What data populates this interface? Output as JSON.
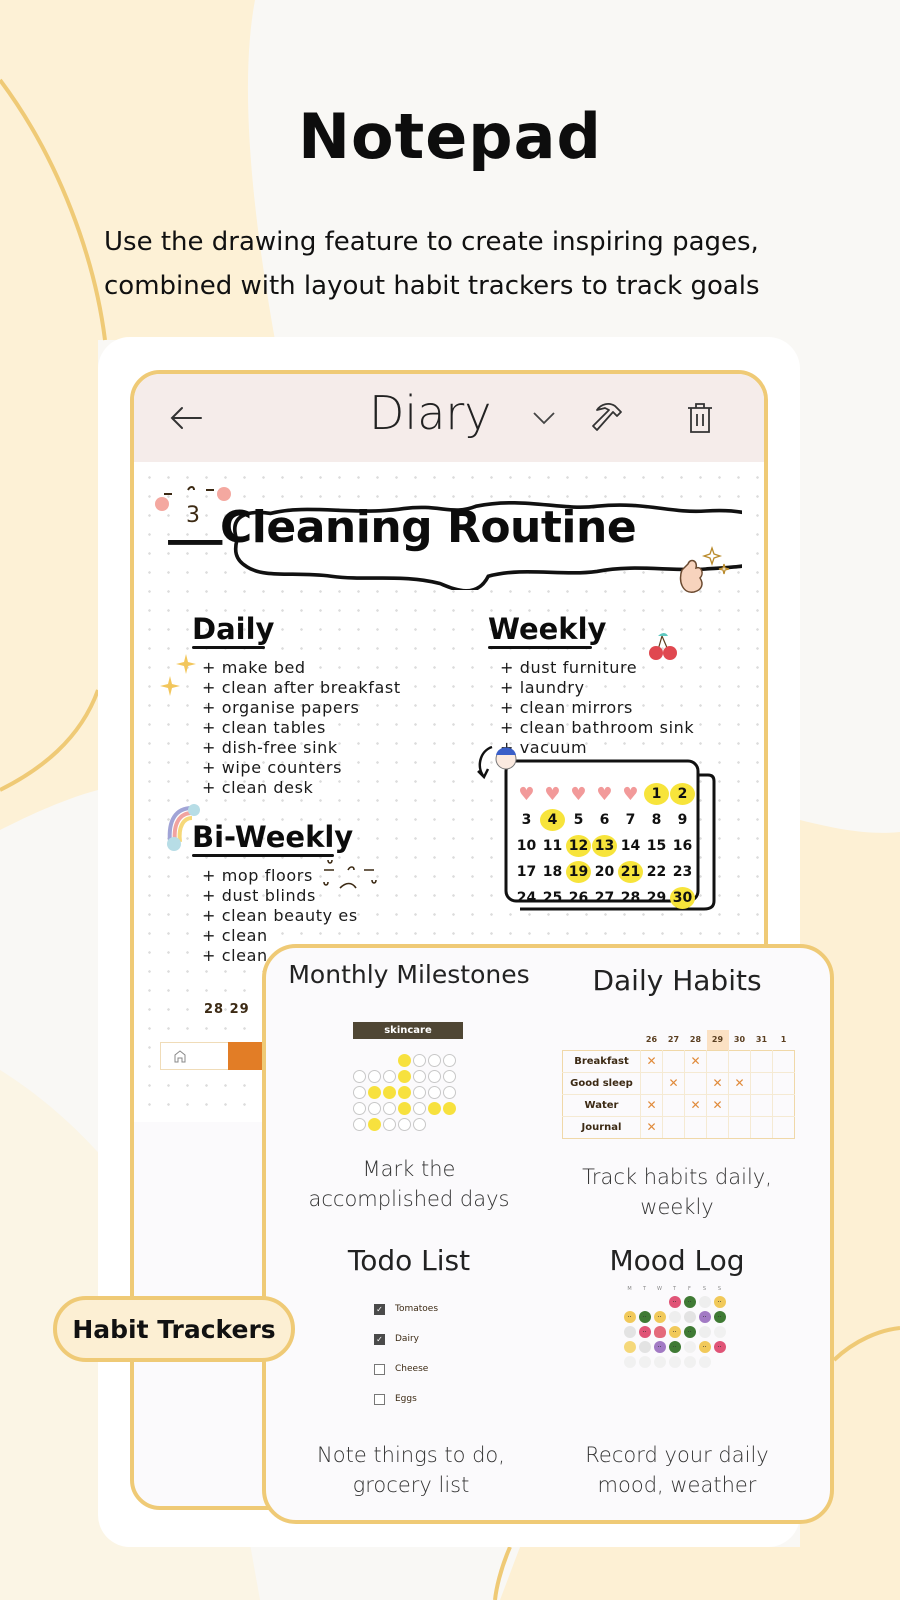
{
  "hero": {
    "title": "Notepad",
    "subtitle": "Use the drawing feature to create inspiring pages, combined with layout habit trackers to track goals"
  },
  "colors": {
    "accent_border": "#efca76",
    "cream": "#fcefd3",
    "header_bg": "#f5ecea",
    "highlight_yellow": "#f7e43b",
    "orange": "#e27d26"
  },
  "app": {
    "header": {
      "back_icon": "arrow-left-icon",
      "title": "Diary",
      "dropdown_icon": "chevron-down-icon",
      "tools_icon": "hammer-icon",
      "delete_icon": "trash-icon"
    },
    "note": {
      "banner_title": "Cleaning Routine",
      "daily": {
        "title": "Daily",
        "items": [
          "make bed",
          "clean after breakfast",
          "organise papers",
          "clean tables",
          "dish-free sink",
          "wipe counters",
          "clean desk"
        ]
      },
      "weekly": {
        "title": "Weekly",
        "items": [
          "dust furniture",
          "laundry",
          "clean mirrors",
          "clean bathroom sink",
          "vacuum"
        ]
      },
      "biweekly": {
        "title": "Bi-Weekly",
        "items": [
          "mop floors",
          "dust blinds",
          "clean beauty es",
          "clean",
          "clean"
        ]
      },
      "calendar": {
        "leading_hearts": 5,
        "days": [
          1,
          2,
          3,
          4,
          5,
          6,
          7,
          8,
          9,
          10,
          11,
          12,
          13,
          14,
          15,
          16,
          17,
          18,
          19,
          20,
          21,
          22,
          23,
          24,
          25,
          26,
          27,
          28,
          29,
          30
        ],
        "highlighted": [
          1,
          2,
          4,
          12,
          13,
          19,
          21,
          30
        ]
      },
      "small_dates": "28 29",
      "home_icon": "home-icon"
    }
  },
  "features": {
    "monthly_milestones": {
      "title": "Monthly Milestones",
      "label": "skincare",
      "grid": [
        [
          null,
          null,
          null,
          1,
          0,
          0,
          0
        ],
        [
          0,
          0,
          0,
          1,
          0,
          0,
          0
        ],
        [
          0,
          1,
          1,
          1,
          0,
          0,
          0
        ],
        [
          0,
          0,
          0,
          1,
          0,
          1,
          1
        ],
        [
          0,
          1,
          0,
          0,
          0
        ]
      ],
      "description": "Mark the accomplished days"
    },
    "daily_habits": {
      "title": "Daily Habits",
      "columns": [
        "26",
        "27",
        "28",
        "29",
        "30",
        "31",
        "1"
      ],
      "today_column": "29",
      "rows": [
        {
          "habit": "Breakfast",
          "marks": [
            1,
            0,
            1,
            0,
            0,
            0,
            0
          ]
        },
        {
          "habit": "Good sleep",
          "marks": [
            0,
            1,
            0,
            1,
            1,
            0,
            0
          ]
        },
        {
          "habit": "Water",
          "marks": [
            1,
            0,
            1,
            1,
            0,
            0,
            0
          ]
        },
        {
          "habit": "Journal",
          "marks": [
            1,
            0,
            0,
            0,
            0,
            0,
            0
          ]
        }
      ],
      "description": "Track habits daily, weekly"
    },
    "todo_list": {
      "title": "Todo List",
      "items": [
        {
          "text": "Tomatoes",
          "checked": true
        },
        {
          "text": "Dairy",
          "checked": true
        },
        {
          "text": "Cheese",
          "checked": false
        },
        {
          "text": "Eggs",
          "checked": false
        }
      ],
      "description": "Note things to do, grocery list"
    },
    "mood_log": {
      "title": "Mood Log",
      "weekdays": [
        "M",
        "T",
        "W",
        "T",
        "F",
        "S",
        "S"
      ],
      "weeks": [
        [
          "",
          "",
          "",
          "pink",
          "green",
          "cloud-sun",
          "yellow"
        ],
        [
          "yellow",
          "green",
          "yellow",
          "cloud-sun",
          "cloud",
          "purple",
          "green"
        ],
        [
          "cloud",
          "pink",
          "heart",
          "yellow",
          "green",
          "cloud-sun",
          "empty"
        ],
        [
          "sun",
          "cloud",
          "purple",
          "green",
          "empty",
          "yellow",
          "pink"
        ],
        [
          "empty",
          "empty",
          "empty",
          "empty",
          "empty",
          "empty",
          ""
        ]
      ],
      "description": "Record your daily mood, weather"
    }
  },
  "badge": {
    "label": "Habit Trackers"
  }
}
